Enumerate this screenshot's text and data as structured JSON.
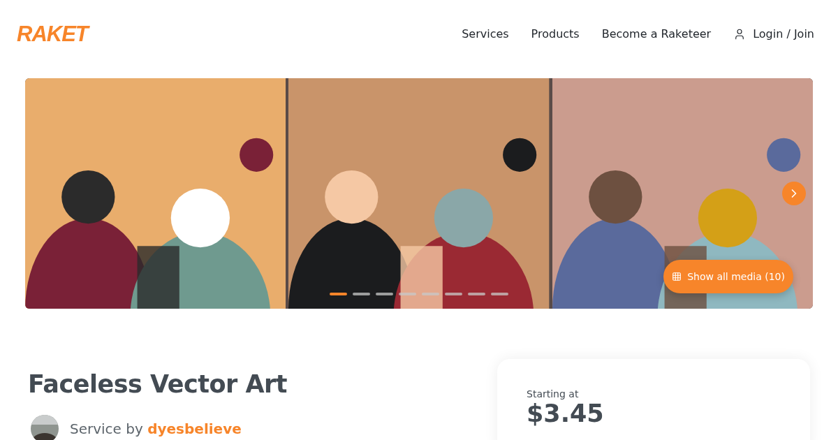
{
  "header": {
    "logo": "RAKET",
    "nav": [
      {
        "label": "Services",
        "kind": "link"
      },
      {
        "label": "Products",
        "kind": "link"
      },
      {
        "label": "Become a Raketeer",
        "kind": "link"
      },
      {
        "label": "Login / Join",
        "kind": "account"
      }
    ]
  },
  "gallery": {
    "dots": [
      {
        "selected": true
      },
      {
        "selected": false
      },
      {
        "selected": false
      },
      {
        "selected": false
      },
      {
        "selected": false
      },
      {
        "selected": false
      },
      {
        "selected": false
      },
      {
        "selected": false
      }
    ],
    "show_all": "Show all media (10)"
  },
  "service": {
    "title": "Faceless Vector Art",
    "by_label": "Service by",
    "seller": "dyesbelieve"
  },
  "price_card": {
    "label": "Starting at",
    "price": "$3.45"
  }
}
